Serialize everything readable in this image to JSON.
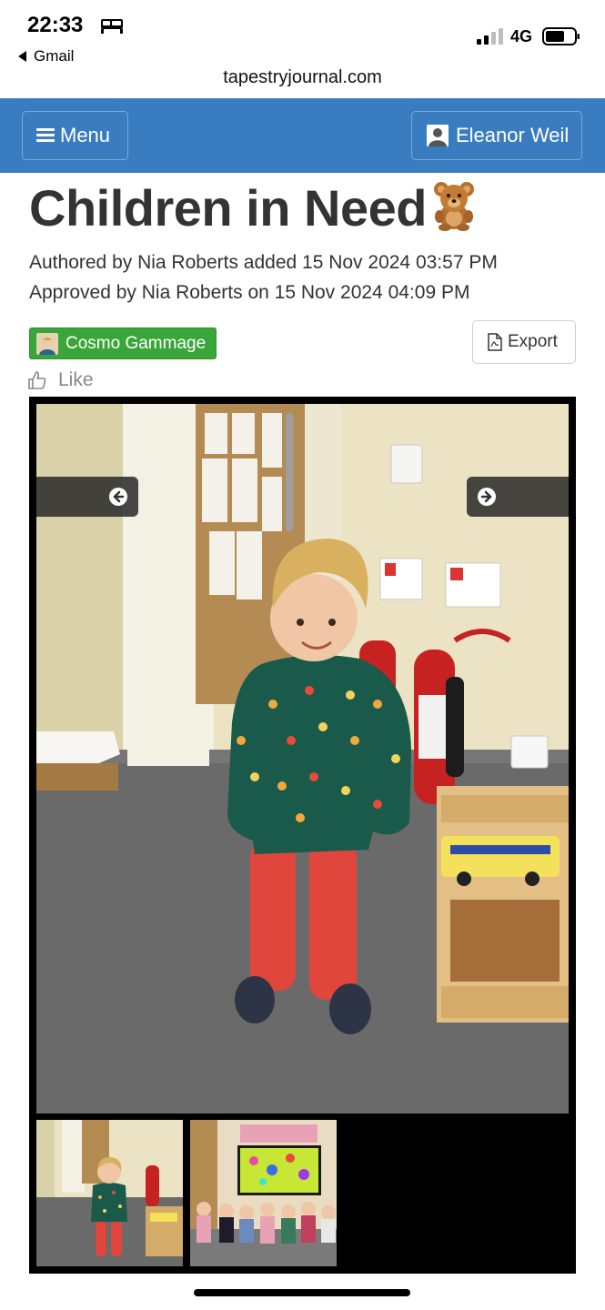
{
  "status_bar": {
    "time": "22:33",
    "back_app": "Gmail",
    "network": "4G",
    "icons": [
      "bed-icon",
      "signal-icon",
      "battery-icon"
    ]
  },
  "browser": {
    "url": "tapestryjournal.com"
  },
  "nav": {
    "menu_label": "Menu",
    "user_name": "Eleanor Weil",
    "bar_color": "#3a7cc0"
  },
  "observation": {
    "title": "Children in Need",
    "title_emoji_icon": "teddy-bear-icon",
    "authored_line": "Authored by Nia Roberts added 15 Nov 2024 03:57 PM",
    "approved_line": "Approved by Nia Roberts on 15 Nov 2024 04:09 PM",
    "child_tag": "Cosmo Gammage",
    "child_tag_color": "#3aa63a",
    "export_label": "Export",
    "like_label": "Like"
  },
  "gallery": {
    "main_photo": "child-in-green-sweater-photo",
    "thumbnails": [
      "child-photo-thumbnail",
      "group-photo-thumbnail"
    ]
  }
}
